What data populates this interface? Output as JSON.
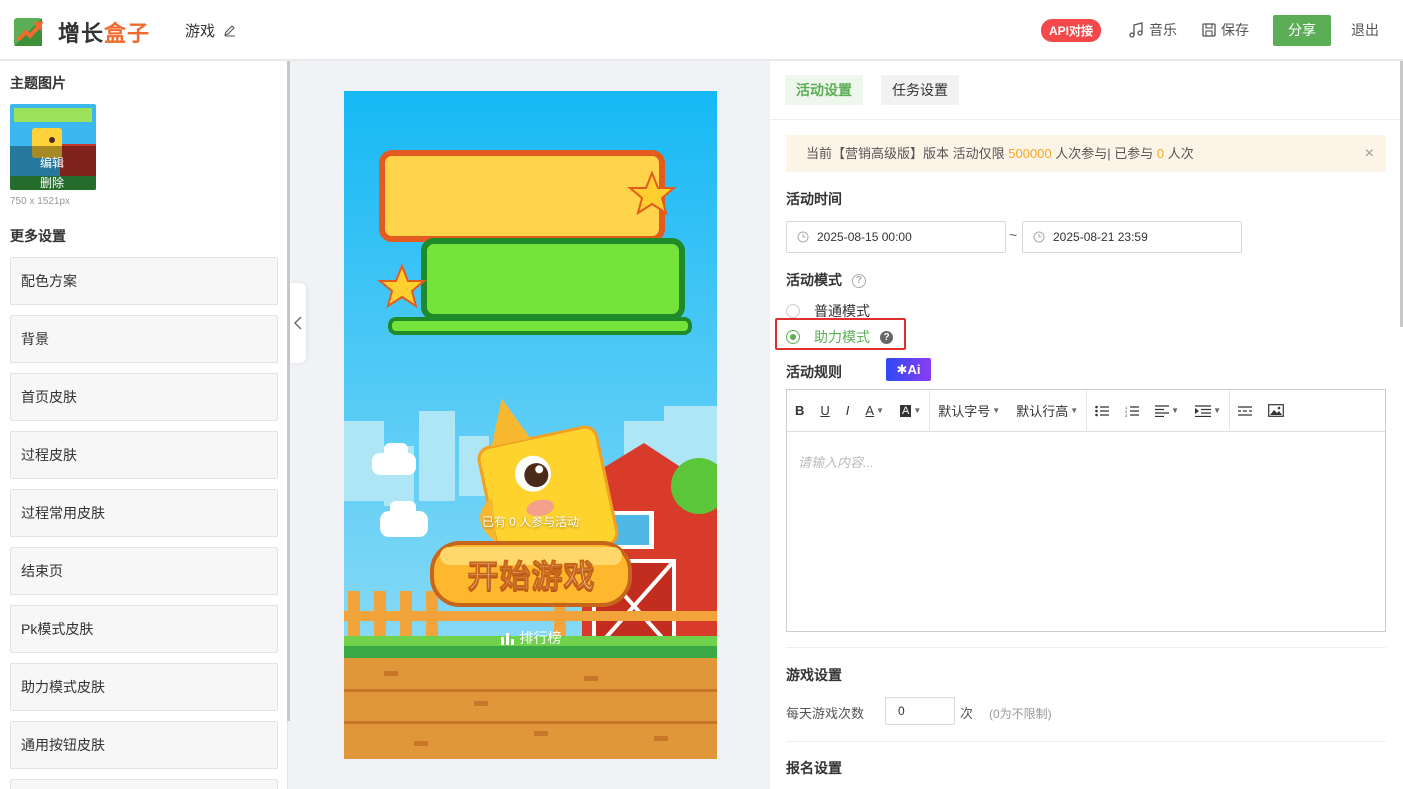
{
  "header": {
    "logo_text_a": "增长",
    "logo_text_b": "盒子",
    "game_name": "游戏",
    "api_badge": "API对接",
    "music_label": "音乐",
    "save_label": "保存",
    "share_label": "分享",
    "exit_label": "退出"
  },
  "left": {
    "theme_title": "主题图片",
    "edit_label": "编辑",
    "delete_label": "删除",
    "image_size": "750 x 1521px",
    "more_title": "更多设置",
    "menu": [
      {
        "label": "配色方案"
      },
      {
        "label": "背景"
      },
      {
        "label": "首页皮肤"
      },
      {
        "label": "过程皮肤"
      },
      {
        "label": "过程常用皮肤"
      },
      {
        "label": "结束页"
      },
      {
        "label": "Pk模式皮肤"
      },
      {
        "label": "助力模式皮肤"
      },
      {
        "label": "通用按钮皮肤"
      }
    ]
  },
  "preview": {
    "participants_text": "已有 0 人参与活动",
    "start_button": "开始游戏",
    "rank_label": "排行榜"
  },
  "right": {
    "tabs": [
      {
        "label": "活动设置"
      },
      {
        "label": "任务设置"
      }
    ],
    "notice": {
      "prefix": "当前【营销高级版】版本 活动仅限",
      "limit": "500000",
      "middle": "人次参与| 已参与",
      "joined": "0",
      "suffix": "人次",
      "close": "×"
    },
    "time_label": "活动时间",
    "start_time": "2025-08-15 00:00",
    "tilde": "~",
    "end_time": "2025-08-21 23:59",
    "mode_label": "活动模式",
    "mode_normal": "普通模式",
    "mode_assist": "助力模式",
    "rules_label": "活动规则",
    "ai_label": "Ai",
    "toolbar": {
      "bold": "B",
      "underline": "U",
      "italic": "I",
      "font_color": "A",
      "bg_color": "A",
      "font_size": "默认字号",
      "line_height": "默认行高"
    },
    "editor_placeholder": "请输入内容...",
    "game_settings_label": "游戏设置",
    "daily_plays_label": "每天游戏次数",
    "daily_plays_value": "0",
    "daily_plays_unit": "次",
    "daily_plays_hint": "(0为不限制)",
    "signup_label": "报名设置"
  },
  "colors": {
    "accent_green": "#5cae56",
    "brand_orange": "#f26a2e",
    "api_red": "#f5484b",
    "highlight_red": "#e0312e",
    "notice_bg": "#fdf4e8",
    "notice_number": "#f5a623"
  }
}
